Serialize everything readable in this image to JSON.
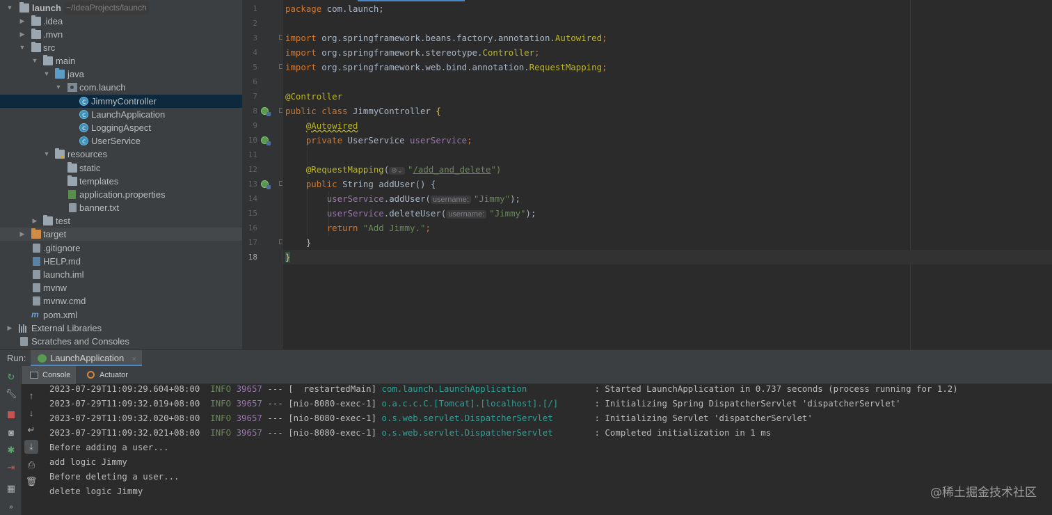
{
  "project": {
    "root_name": "launch",
    "root_path": "~/IdeaProjects/launch",
    "items": [
      {
        "label": "launch",
        "icon": "folder-icon"
      },
      {
        "label": ".idea",
        "icon": "folder-icon"
      },
      {
        "label": ".mvn",
        "icon": "folder-icon"
      },
      {
        "label": "src",
        "icon": "folder-icon"
      },
      {
        "label": "main",
        "icon": "folder-icon"
      },
      {
        "label": "java",
        "icon": "source-folder-icon"
      },
      {
        "label": "com.launch",
        "icon": "package-icon"
      },
      {
        "label": "JimmyController",
        "icon": "java-class-icon"
      },
      {
        "label": "LaunchApplication",
        "icon": "java-class-icon"
      },
      {
        "label": "LoggingAspect",
        "icon": "java-class-icon"
      },
      {
        "label": "UserService",
        "icon": "java-class-icon"
      },
      {
        "label": "resources",
        "icon": "resources-folder-icon"
      },
      {
        "label": "static",
        "icon": "folder-icon"
      },
      {
        "label": "templates",
        "icon": "folder-icon"
      },
      {
        "label": "application.properties",
        "icon": "spring-properties-icon"
      },
      {
        "label": "banner.txt",
        "icon": "text-file-icon"
      },
      {
        "label": "test",
        "icon": "folder-icon"
      },
      {
        "label": "target",
        "icon": "excluded-folder-icon"
      },
      {
        "label": ".gitignore",
        "icon": "text-file-icon"
      },
      {
        "label": "HELP.md",
        "icon": "markdown-file-icon"
      },
      {
        "label": "launch.iml",
        "icon": "iml-file-icon"
      },
      {
        "label": "mvnw",
        "icon": "text-file-icon"
      },
      {
        "label": "mvnw.cmd",
        "icon": "text-file-icon"
      },
      {
        "label": "pom.xml",
        "icon": "maven-icon"
      },
      {
        "label": "External Libraries",
        "icon": "libraries-icon"
      },
      {
        "label": "Scratches and Consoles",
        "icon": "scratches-icon"
      }
    ]
  },
  "editor": {
    "line_numbers": [
      "1",
      "2",
      "3",
      "4",
      "5",
      "6",
      "7",
      "8",
      "9",
      "10",
      "11",
      "12",
      "13",
      "14",
      "15",
      "16",
      "17",
      "18"
    ],
    "tokens": {
      "package_kw": "package",
      "package_name": " com.launch;",
      "import_kw": "import",
      "import1_path": " org.springframework.beans.factory.annotation.",
      "import1_cls": "Autowired",
      "import2_path": " org.springframework.stereotype.",
      "import2_cls": "Controller",
      "import3_path": " org.springframework.web.bind.annotation.",
      "import3_cls": "RequestMapping",
      "semicolon": ";",
      "controller_ann": "@Controller",
      "public_class_kw": "public class",
      "class_name": " JimmyController ",
      "open_brace": "{",
      "close_brace": "}",
      "autowired_ann": "@Autowired",
      "private_kw": "private",
      "field_type": " UserService ",
      "field_name": "userService",
      "reqmap_ann": "@RequestMapping",
      "reqmap_open": "(",
      "reqmap_icon": "⊛⌄",
      "quote": "\"",
      "reqmap_url": "/add_and_delete",
      "reqmap_close": "\")",
      "public_kw": "public",
      "method_sig": " String addUser() {",
      "add_call": ".addUser(",
      "delete_call": ".deleteUser(",
      "param_hint": "username:",
      "arg_value": "\"Jimmy\"",
      "call_close": ");",
      "return_kw": "return",
      "return_value": " \"Add Jimmy.\"",
      "method_close": "}"
    }
  },
  "run": {
    "label": "Run:",
    "tab": "LaunchApplication",
    "close": "×",
    "subtabs": [
      "Console",
      "Actuator"
    ],
    "log_lines": [
      {
        "ts": "2023-07-29T11:09:29.604+08:00",
        "level": "INFO",
        "pid": "39657",
        "sep": "---",
        "thread": "[  restartedMain]",
        "logger": "com.launch.LaunchApplication",
        "msg": ": Started LaunchApplication in 0.737 seconds (process running for 1.2)"
      },
      {
        "ts": "2023-07-29T11:09:32.019+08:00",
        "level": "INFO",
        "pid": "39657",
        "sep": "---",
        "thread": "[nio-8080-exec-1]",
        "logger": "o.a.c.c.C.[Tomcat].[localhost].[/]",
        "msg": ": Initializing Spring DispatcherServlet 'dispatcherServlet'"
      },
      {
        "ts": "2023-07-29T11:09:32.020+08:00",
        "level": "INFO",
        "pid": "39657",
        "sep": "---",
        "thread": "[nio-8080-exec-1]",
        "logger": "o.s.web.servlet.DispatcherServlet",
        "msg": ": Initializing Servlet 'dispatcherServlet'"
      },
      {
        "ts": "2023-07-29T11:09:32.021+08:00",
        "level": "INFO",
        "pid": "39657",
        "sep": "---",
        "thread": "[nio-8080-exec-1]",
        "logger": "o.s.web.servlet.DispatcherServlet",
        "msg": ": Completed initialization in 1 ms"
      }
    ],
    "output_lines": [
      "Before adding a user...",
      "add logic Jimmy",
      "Before deleting a user...",
      "delete logic Jimmy"
    ]
  },
  "watermark": "@稀土掘金技术社区",
  "colors": {
    "keyword": "#cc7832",
    "annotation": "#bbb529",
    "string": "#6a8759",
    "field": "#9876aa",
    "accent": "#4a88c7"
  }
}
